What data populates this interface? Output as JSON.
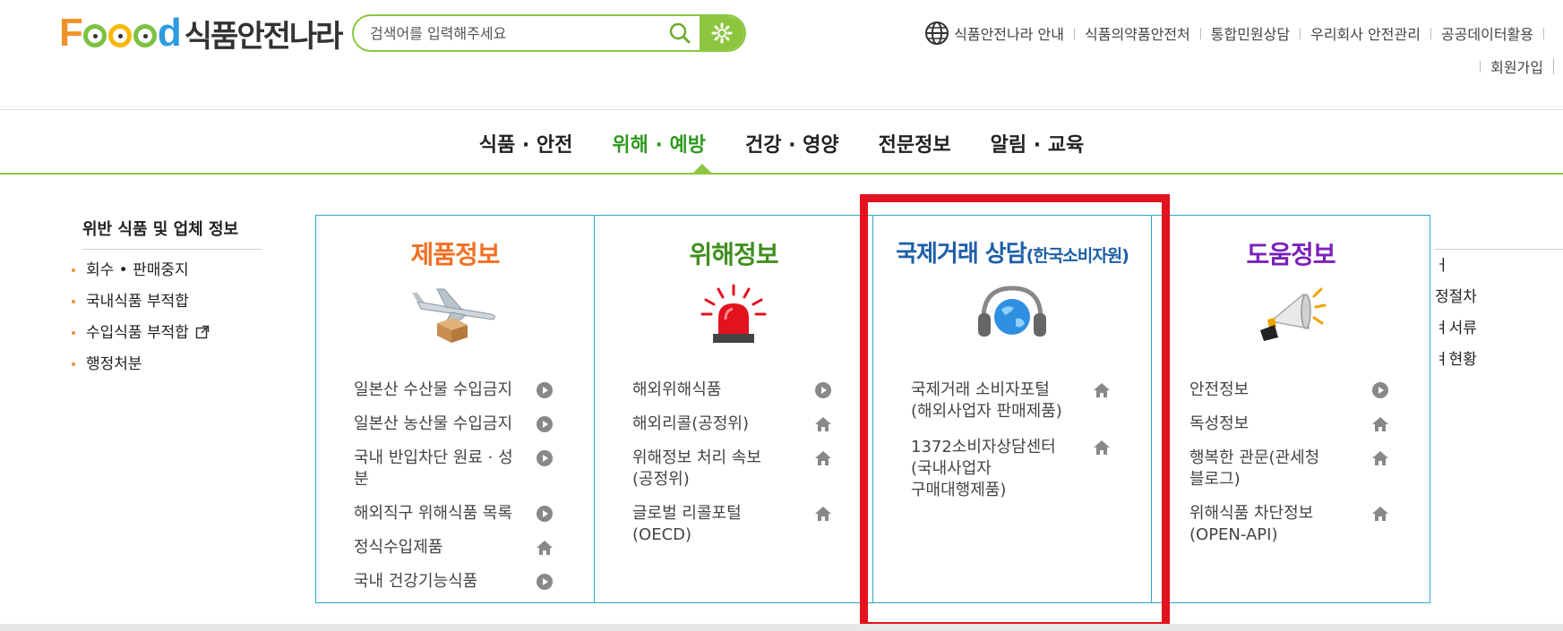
{
  "logo": {
    "brand_f": "F",
    "brand_d": "d",
    "korean": "식품안전나라"
  },
  "search": {
    "placeholder": "검색어를 입력해주세요"
  },
  "top_links": [
    "식품안전나라 안내",
    "식품의약품안전처",
    "통합민원상담",
    "우리회사 안전관리",
    "공공데이터활용"
  ],
  "top_links2": [
    "회원가입"
  ],
  "gnb": [
    "식품 · 안전",
    "위해 · 예방",
    "건강 · 영양",
    "전문정보",
    "알림 · 교육"
  ],
  "left_menu": {
    "title": "위반 식품 및 업체 정보",
    "items": [
      "회수 • 판매중지",
      "국내식품 부적합",
      "수입식품 부적합",
      "행정처분"
    ]
  },
  "right_menu": [
    "ㅓ",
    "정절차",
    "ㅕ서류",
    "ㅕ현황"
  ],
  "panel": {
    "product": {
      "title": "제품정보",
      "color": "#f26f21",
      "links": [
        "일본산 수산물 수입금지",
        "일본산 농산물 수입금지",
        "국내 반입차단 원료 · 성분",
        "해외직구 위해식품 목록",
        "정식수입제품",
        "국내 건강기능식품"
      ],
      "icons": [
        "play-circle-icon",
        "play-circle-icon",
        "play-circle-icon",
        "play-circle-icon",
        "home-icon",
        "play-circle-icon"
      ]
    },
    "hazard": {
      "title": "위해정보",
      "color": "#3f8f1e",
      "links": [
        "해외위해식품",
        "해외리콜(공정위)",
        "위해정보 처리 속보\n(공정위)",
        "글로벌 리콜포털\n(OECD)"
      ],
      "icons": [
        "play-circle-icon",
        "home-icon",
        "home-icon",
        "home-icon"
      ]
    },
    "intl": {
      "title": "국제거래 상담",
      "title_sub": "(한국소비자원)",
      "color": "#1d5fa8",
      "links": [
        "국제거래 소비자포털\n(해외사업자 판매제품)",
        "1372소비자상담센터\n(국내사업자\n구매대행제품)"
      ],
      "icons": [
        "home-icon",
        "home-icon"
      ]
    },
    "help": {
      "title": "도움정보",
      "color": "#7a22b8",
      "links": [
        "안전정보",
        "독성정보",
        "행복한 관문(관세청\n블로그)",
        "위해식품 차단정보\n(OPEN-API)"
      ],
      "icons": [
        "play-circle-icon",
        "home-icon",
        "home-icon",
        "home-icon"
      ]
    }
  },
  "colors": {
    "green": "#8cc63f",
    "panel_border": "#2aa9c9",
    "highlight": "#e3121f"
  }
}
